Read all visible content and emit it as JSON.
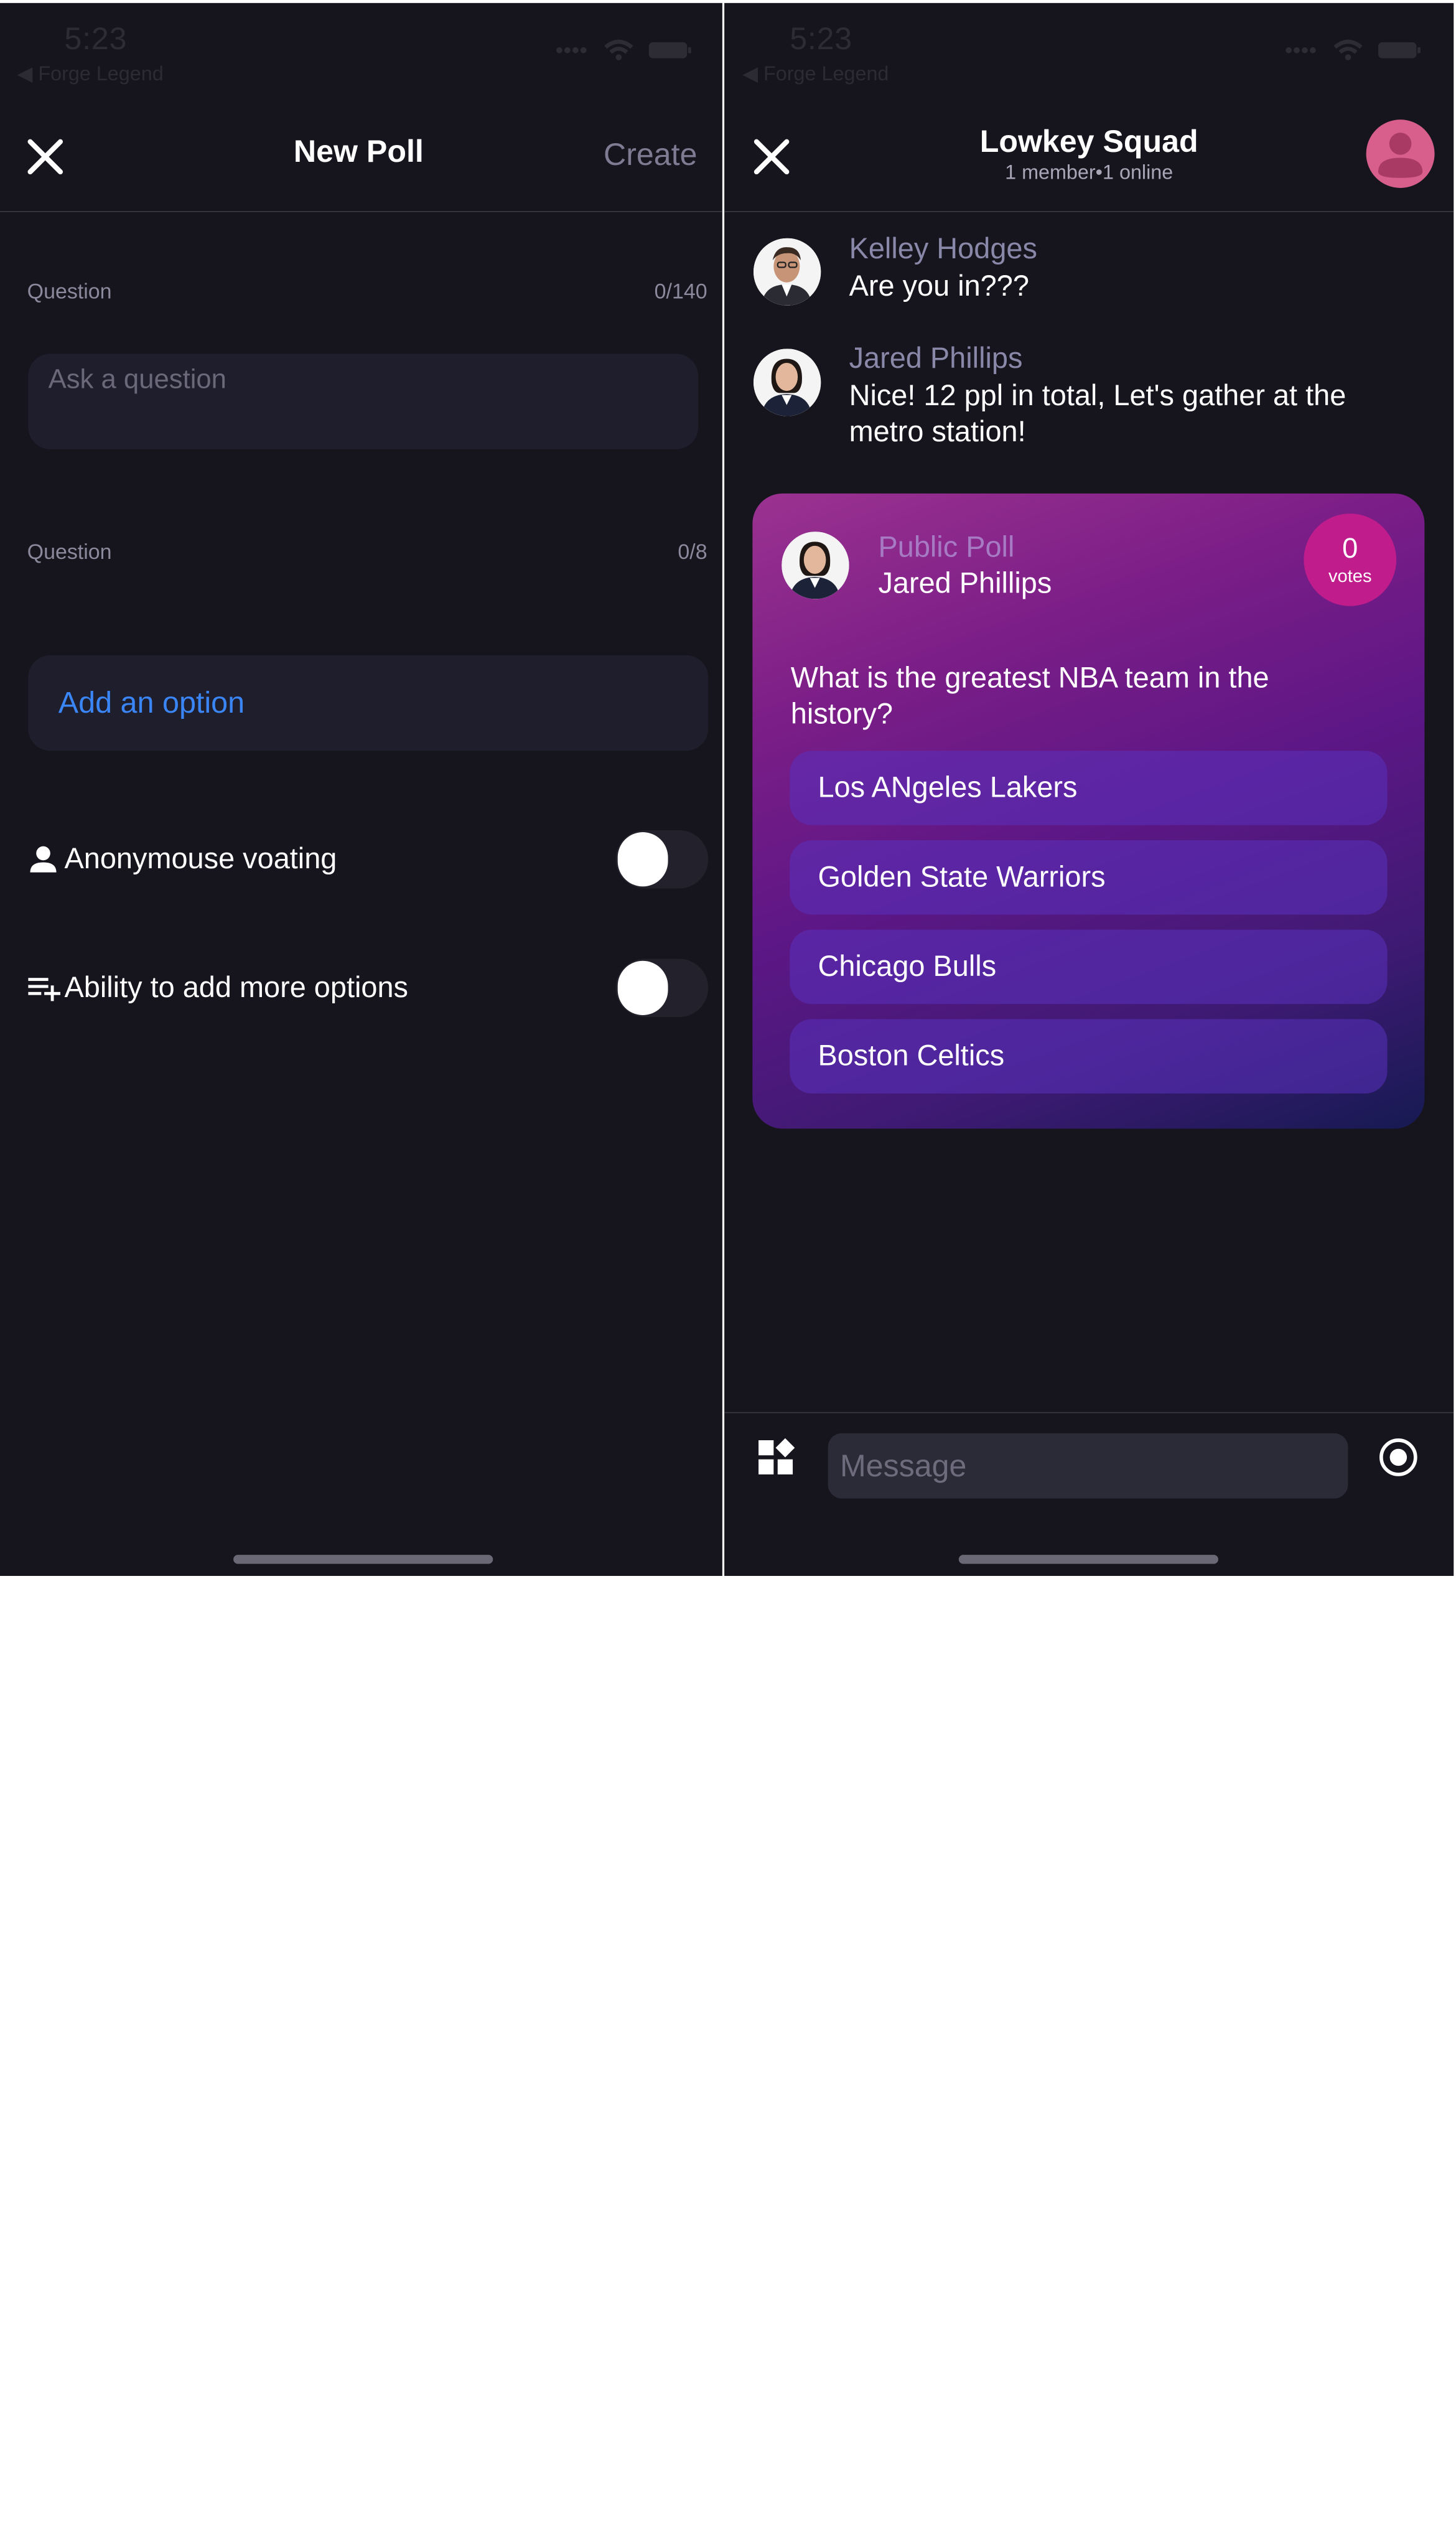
{
  "left_screen": {
    "status": {
      "time": "5:23",
      "back_app": "◀ Forge Legend"
    },
    "nav": {
      "title": "New Poll",
      "create_label": "Create"
    },
    "question_field": {
      "label": "Question",
      "count": "0/140",
      "placeholder": "Ask a question"
    },
    "options_field": {
      "label": "Question",
      "count": "0/8",
      "add_option_label": "Add an option"
    },
    "settings": [
      {
        "label": "Anonymouse voating",
        "icon": "person-icon",
        "enabled": false
      },
      {
        "label": "Ability to add more options",
        "icon": "playlist-add-icon",
        "enabled": false
      }
    ]
  },
  "right_screen": {
    "status": {
      "time": "5:23",
      "back_app": "◀ Forge Legend"
    },
    "header": {
      "title": "Lowkey Squad",
      "subtitle": "1 member•1 online"
    },
    "messages": [
      {
        "author": "Kelley Hodges",
        "text": "Are you in???"
      },
      {
        "author": "Jared Phillips",
        "text": "Nice! 12 ppl in total, Let's gather at the metro station!"
      }
    ],
    "poll": {
      "kind": "Public Poll",
      "author": "Jared Phillips",
      "votes_count": "0",
      "votes_label": "votes",
      "question": "What is the greatest NBA team in the history?",
      "options": [
        "Los ANgeles Lakers",
        "Golden State Warriors",
        "Chicago Bulls",
        "Boston Celtics"
      ]
    },
    "composer": {
      "placeholder": "Message"
    }
  },
  "colors": {
    "background": "#16151d",
    "field_background": "#1f1e2c",
    "link_blue": "#3a86f6",
    "muted_text": "#8b899c",
    "votes_badge": "#c01c8c",
    "group_avatar": "#d85f8c"
  }
}
